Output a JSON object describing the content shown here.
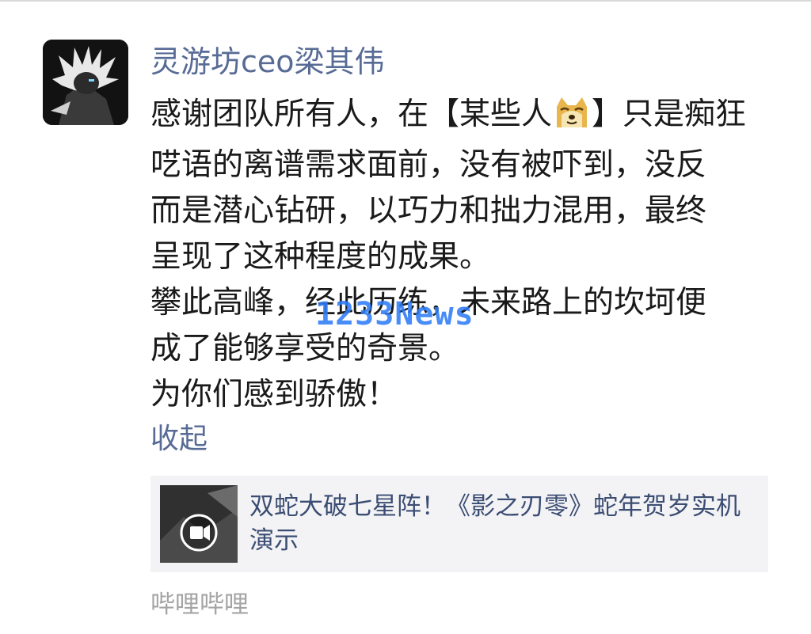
{
  "post": {
    "author": "灵游坊ceo梁其伟",
    "line1_before": "感谢团队所有人，在【某些人",
    "line1_after": "】只是痴狂",
    "line2": "呓语的离谱需求面前，没有被吓到，没反",
    "line3": "而是潜心钻研，以巧力和拙力混用，最终",
    "line4": "呈现了这种程度的成果。",
    "line5": "攀此高峰，经此历练，未来路上的坎坷便",
    "line6": "成了能够享受的奇景。",
    "line7": "为你们感到骄傲！",
    "emoji": "doge-emoji",
    "collapse_label": "收起"
  },
  "share_card": {
    "title": "双蛇大破七星阵！《影之刃零》蛇年贺岁实机演示",
    "thumb_icon": "video-play-icon"
  },
  "source": "哔哩哔哩",
  "watermark": "1233News",
  "colors": {
    "link": "#576b95",
    "text": "#1a1a1a",
    "card_bg": "#f3f3f5",
    "muted": "#a4a4a4",
    "watermark": "#2f7df6"
  }
}
